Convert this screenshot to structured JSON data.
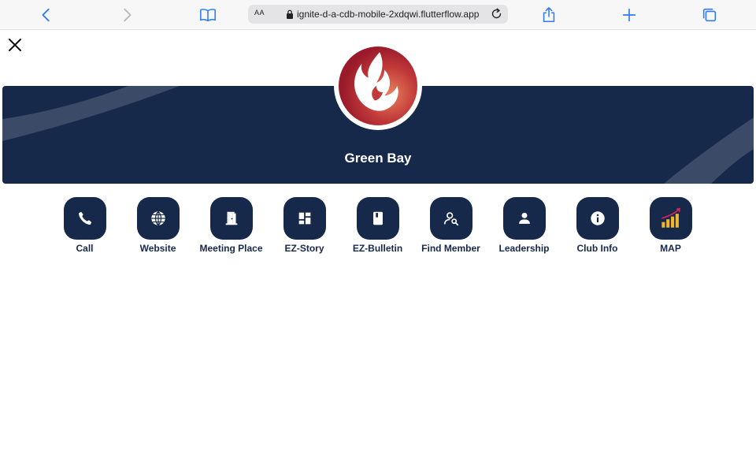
{
  "browser": {
    "text_size_label": "AA",
    "url": "ignite-d-a-cdb-mobile-2xdqwi.flutterflow.app"
  },
  "club": {
    "name": "Green Bay"
  },
  "colors": {
    "navy": "#16294b",
    "logo_red": "#a3202c",
    "browser_blue": "#2f7bf5"
  },
  "actions": [
    {
      "label": "Call",
      "icon": "phone-icon"
    },
    {
      "label": "Website",
      "icon": "globe-icon"
    },
    {
      "label": "Meeting Place",
      "icon": "door-icon"
    },
    {
      "label": "EZ-Story",
      "icon": "dashboard-icon"
    },
    {
      "label": "EZ-Bulletin",
      "icon": "book-icon"
    },
    {
      "label": "Find Member",
      "icon": "person-search-icon"
    },
    {
      "label": "Leadership",
      "icon": "person-icon"
    },
    {
      "label": "Club Info",
      "icon": "info-icon"
    },
    {
      "label": "MAP",
      "icon": "growth-chart-icon"
    }
  ]
}
